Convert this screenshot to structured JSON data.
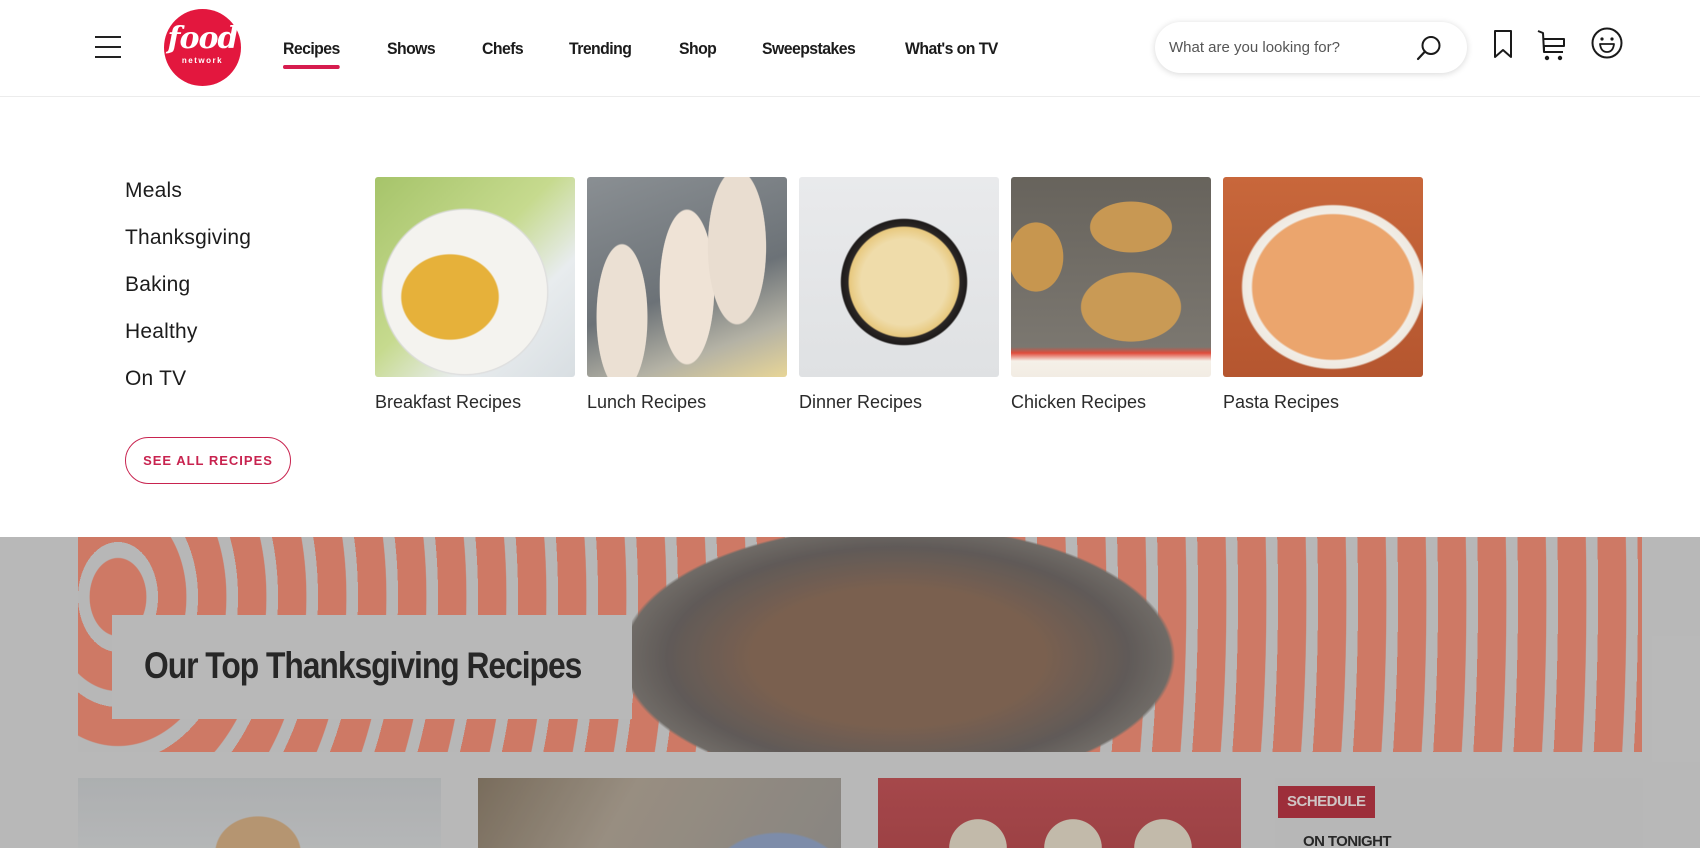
{
  "header": {
    "logo": {
      "word": "food",
      "sub": "network"
    },
    "nav": [
      {
        "label": "Recipes",
        "active": true
      },
      {
        "label": "Shows"
      },
      {
        "label": "Chefs"
      },
      {
        "label": "Trending"
      },
      {
        "label": "Shop"
      },
      {
        "label": "Sweepstakes"
      },
      {
        "label": "What's on TV"
      }
    ],
    "search": {
      "placeholder": "What are you looking for?",
      "value": ""
    },
    "icons": [
      "menu-icon",
      "search-icon",
      "bookmark-icon",
      "cart-icon",
      "profile-smiley-icon"
    ]
  },
  "mega_menu": {
    "categories": [
      "Meals",
      "Thanksgiving",
      "Baking",
      "Healthy",
      "On TV"
    ],
    "see_all_label": "SEE ALL RECIPES",
    "tiles": [
      {
        "label": "Breakfast Recipes",
        "image": "waffles"
      },
      {
        "label": "Lunch Recipes",
        "image": "wraps"
      },
      {
        "label": "Dinner Recipes",
        "image": "skillet-casserole"
      },
      {
        "label": "Chicken Recipes",
        "image": "breaded-chicken"
      },
      {
        "label": "Pasta Recipes",
        "image": "rigatoni"
      }
    ]
  },
  "banner": {
    "title": "Our Top Thanksgiving Recipes"
  },
  "cards": [
    {
      "image": "turkey-craft"
    },
    {
      "image": "market-hall"
    },
    {
      "image": "penguin-cookies"
    }
  ],
  "schedule": {
    "badge": "SCHEDULE",
    "subtitle": "ON TONIGHT"
  },
  "colors": {
    "brand_red": "#e3173e",
    "accent_pink": "#c8234f",
    "schedule_red": "#a81a2a"
  }
}
